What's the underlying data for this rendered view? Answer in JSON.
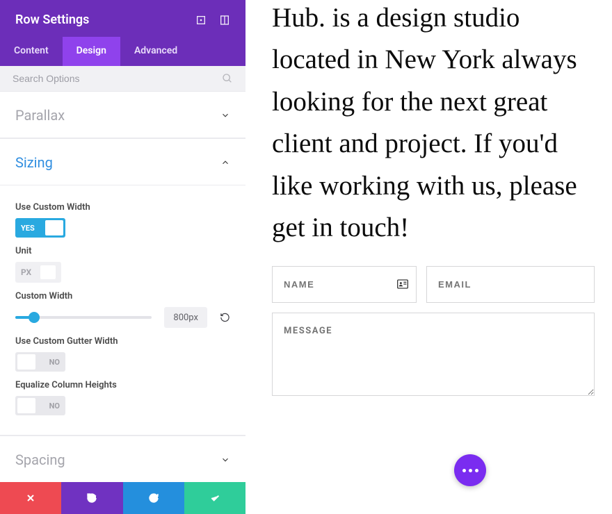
{
  "panel": {
    "title": "Row Settings",
    "tabs": {
      "content": "Content",
      "design": "Design",
      "advanced": "Advanced"
    },
    "search_placeholder": "Search Options",
    "sections": {
      "parallax": {
        "title": "Parallax"
      },
      "sizing": {
        "title": "Sizing",
        "use_custom_width_label": "Use Custom Width",
        "use_custom_width_state": "YES",
        "unit_label": "Unit",
        "unit_value": "PX",
        "custom_width_label": "Custom Width",
        "custom_width_value": "800px",
        "use_custom_gutter_label": "Use Custom Gutter Width",
        "use_custom_gutter_state": "NO",
        "equalize_label": "Equalize Column Heights",
        "equalize_state": "NO"
      },
      "spacing": {
        "title": "Spacing"
      }
    }
  },
  "preview": {
    "hero": "Hub. is a design studio located in New York always looking for the next great client and project. If you'd like working with us, please get in touch!",
    "name_placeholder": "NAME",
    "email_placeholder": "EMAIL",
    "message_placeholder": "MESSAGE"
  },
  "colors": {
    "primary_purple": "#6c2eb9",
    "active_purple": "#8f42ec",
    "accent_blue": "#29a9e0",
    "green": "#2fcd9a",
    "red": "#ee4a52"
  }
}
